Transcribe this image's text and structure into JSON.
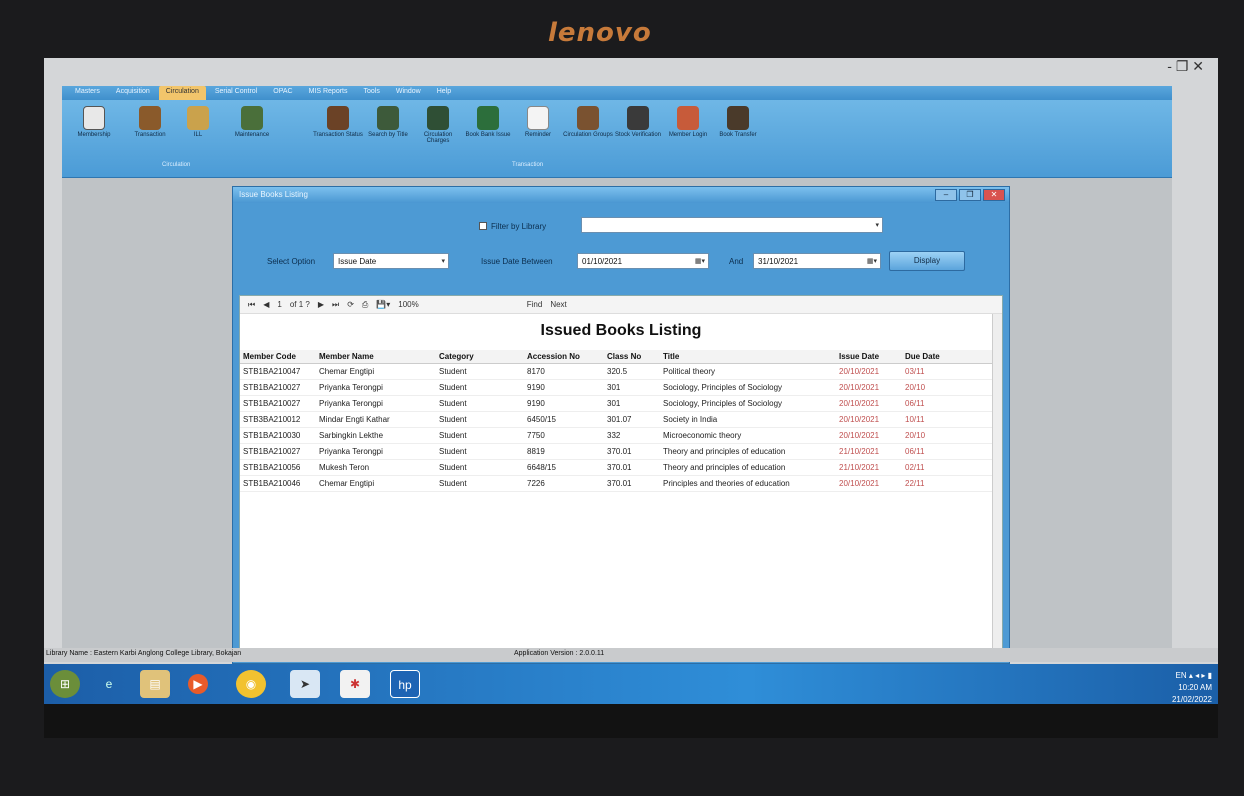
{
  "device": {
    "brand": "lenovo"
  },
  "window_controls": "- ❐ ✕",
  "ribbon": {
    "tabs": [
      "Masters",
      "Acquisition",
      "Circulation",
      "Serial Control",
      "OPAC",
      "MIS Reports",
      "Tools",
      "Window",
      "Help"
    ],
    "active_tab_index": 2,
    "buttons": [
      "Membership",
      "Transaction",
      "ILL",
      "Maintenance",
      "Transaction Status",
      "Search by Title",
      "Circulation Charges",
      "Book Bank Issue",
      "Reminder",
      "Circulation Groups",
      "Stock Verification",
      "Member Login",
      "Book Transfer"
    ],
    "group_labels": [
      "Circulation",
      "Transaction"
    ]
  },
  "dialog": {
    "title": "Issue Books Listing",
    "filter_by_library_label": "Filter by Library",
    "library_value": "",
    "select_option_label": "Select Option",
    "select_option_value": "Issue Date",
    "issue_date_between_label": "Issue Date Between",
    "date_from": "01/10/2021",
    "and_label": "And",
    "date_to": "31/10/2021",
    "display_button": "Display"
  },
  "report": {
    "toolbar": {
      "page": "1",
      "of_pages": "of 1 ?",
      "zoom": "100%",
      "find": "Find",
      "next": "Next"
    },
    "title": "Issued Books Listing",
    "columns": [
      "Member Code",
      "Member Name",
      "Category",
      "Accession No",
      "Class No",
      "Title",
      "Issue Date",
      "Due Date"
    ],
    "rows": [
      [
        "STB1BA210047",
        "Chemar Engtipi",
        "Student",
        "8170",
        "320.5",
        "Political theory",
        "20/10/2021",
        "03/11"
      ],
      [
        "STB1BA210027",
        "Priyanka Terongpi",
        "Student",
        "9190",
        "301",
        "Sociology, Principles of Sociology",
        "20/10/2021",
        "20/10"
      ],
      [
        "STB1BA210027",
        "Priyanka Terongpi",
        "Student",
        "9190",
        "301",
        "Sociology, Principles of Sociology",
        "20/10/2021",
        "06/11"
      ],
      [
        "STB3BA210012",
        "Mindar Engti Kathar",
        "Student",
        "6450/15",
        "301.07",
        "Society in India",
        "20/10/2021",
        "10/11"
      ],
      [
        "STB1BA210030",
        "Sarbingkin Lekthe",
        "Student",
        "7750",
        "332",
        "Microeconomic theory",
        "20/10/2021",
        "20/10"
      ],
      [
        "STB1BA210027",
        "Priyanka Terongpi",
        "Student",
        "8819",
        "370.01",
        "Theory and principles of education",
        "21/10/2021",
        "06/11"
      ],
      [
        "STB1BA210056",
        "Mukesh Teron",
        "Student",
        "6648/15",
        "370.01",
        "Theory and principles of education",
        "21/10/2021",
        "02/11"
      ],
      [
        "STB1BA210046",
        "Chemar Engtipi",
        "Student",
        "7226",
        "370.01",
        "Principles and theories of education",
        "20/10/2021",
        "22/11"
      ]
    ]
  },
  "status_bar": {
    "library_name": "Library Name : Eastern Karbi Anglong College Library, Bokajan",
    "app_version": "Application Version : 2.0.0.11"
  },
  "taskbar": {
    "apps": [
      "start-icon",
      "ie-icon",
      "explorer-icon",
      "media-icon",
      "chrome-icon",
      "app-icon",
      "library-app-icon",
      "hp-icon"
    ],
    "tray_lang": "EN",
    "clock_time": "10:20 AM",
    "clock_date": "21/02/2022"
  }
}
